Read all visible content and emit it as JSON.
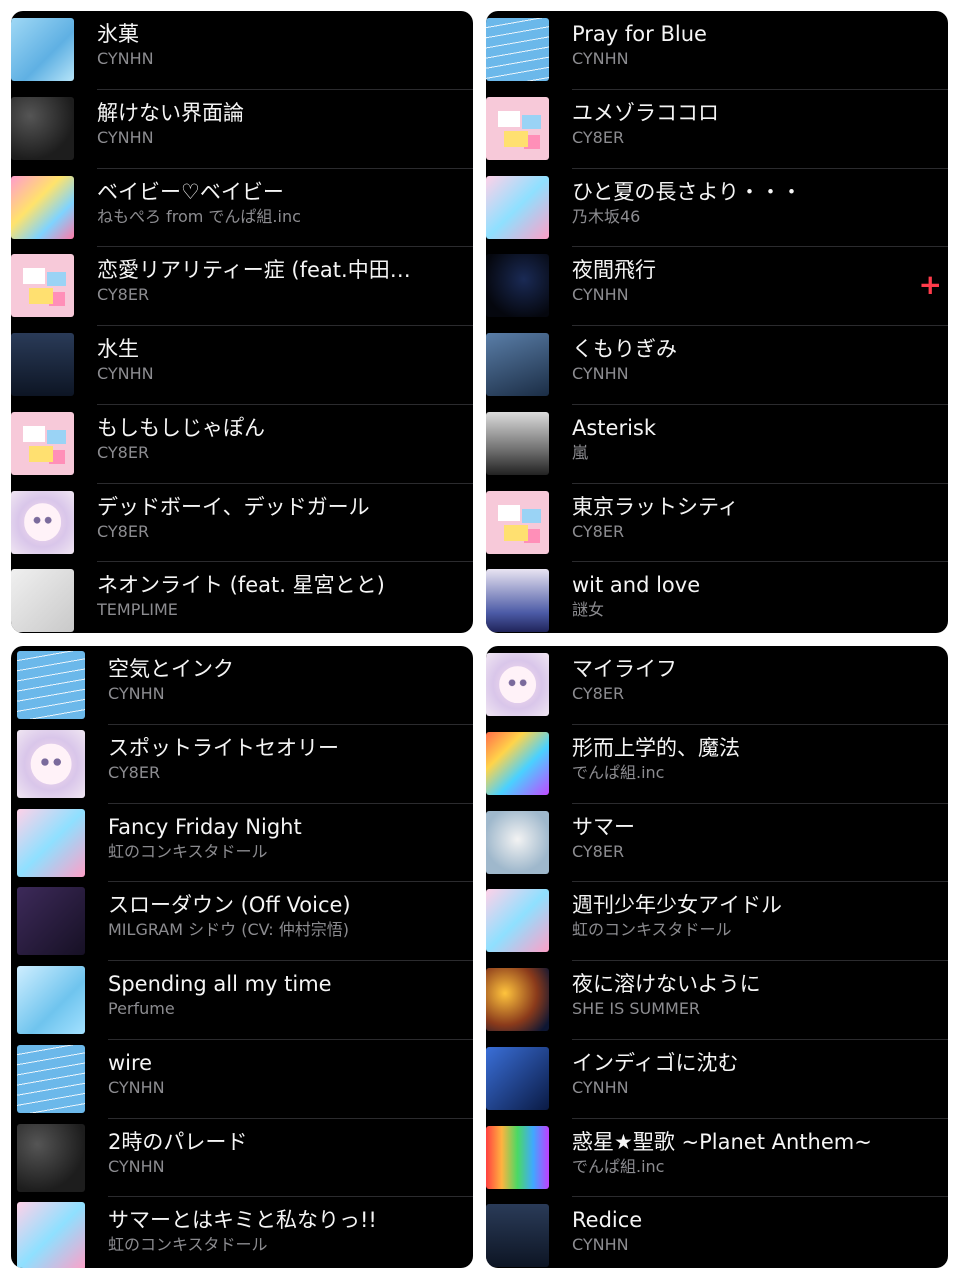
{
  "panels": [
    {
      "tracks": [
        {
          "title": "氷菓",
          "artist": "CYNHN",
          "art": "a-blue"
        },
        {
          "title": "解けない界面論",
          "artist": "CYNHN",
          "art": "a-dark"
        },
        {
          "title": "ベイビー♡ベイビー",
          "artist": "ねもぺろ from でんぱ組.inc",
          "art": "a-pop"
        },
        {
          "title": "恋愛リアリティー症 (feat.中田…",
          "artist": "CY8ER",
          "art": "a-pink"
        },
        {
          "title": "水生",
          "artist": "CYNHN",
          "art": "a-night"
        },
        {
          "title": "もしもしじゃぽん",
          "artist": "CY8ER",
          "art": "a-pink"
        },
        {
          "title": "デッドボーイ、デッドガール",
          "artist": "CY8ER",
          "art": "a-skull"
        },
        {
          "title": "ネオンライト (feat. 星宮とと)",
          "artist": "TEMPLIME",
          "art": "a-gray"
        }
      ]
    },
    {
      "tracks": [
        {
          "title": "Pray for Blue",
          "artist": "CYNHN",
          "art": "a-lines"
        },
        {
          "title": "ユメゾラココロ",
          "artist": "CY8ER",
          "art": "a-pink"
        },
        {
          "title": "ひと夏の長さより・・・",
          "artist": "乃木坂46",
          "art": "a-idol"
        },
        {
          "title": "夜間飛行",
          "artist": "CYNHN",
          "art": "a-stars",
          "add": "+"
        },
        {
          "title": "くもりぎみ",
          "artist": "CYNHN",
          "art": "a-city"
        },
        {
          "title": "Asterisk",
          "artist": "嵐",
          "art": "a-group"
        },
        {
          "title": "東京ラットシティ",
          "artist": "CY8ER",
          "art": "a-pink"
        },
        {
          "title": "wit and love",
          "artist": "謎女",
          "art": "a-anime"
        }
      ]
    },
    {
      "tracks": [
        {
          "title": "空気とインク",
          "artist": "CYNHN",
          "art": "a-lines"
        },
        {
          "title": "スポットライトセオリー",
          "artist": "CY8ER",
          "art": "a-skull"
        },
        {
          "title": "Fancy Friday Night",
          "artist": "虹のコンキスタドール",
          "art": "a-idol"
        },
        {
          "title": "スローダウン (Off Voice)",
          "artist": "MILGRAM シドウ (CV: 仲村宗悟)",
          "art": "a-purple"
        },
        {
          "title": "Spending all my time",
          "artist": "Perfume",
          "art": "a-aqua"
        },
        {
          "title": "wire",
          "artist": "CYNHN",
          "art": "a-lines"
        },
        {
          "title": "2時のパレード",
          "artist": "CYNHN",
          "art": "a-dark"
        },
        {
          "title": "サマーとはキミと私なりっ!!",
          "artist": "虹のコンキスタドール",
          "art": "a-idol"
        }
      ]
    },
    {
      "tracks": [
        {
          "title": "マイライフ",
          "artist": "CY8ER",
          "art": "a-skull"
        },
        {
          "title": "形而上学的、魔法",
          "artist": "でんぱ組.inc",
          "art": "a-multi"
        },
        {
          "title": "サマー",
          "artist": "CY8ER",
          "art": "a-face"
        },
        {
          "title": "週刊少年少女アイドル",
          "artist": "虹のコンキスタドール",
          "art": "a-idol"
        },
        {
          "title": "夜に溶けないように",
          "artist": "SHE IS SUMMER",
          "art": "a-sunset"
        },
        {
          "title": "インディゴに沈む",
          "artist": "CYNHN",
          "art": "a-indigo"
        },
        {
          "title": "惑星★聖歌 ~Planet Anthem~",
          "artist": "でんぱ組.inc",
          "art": "a-rainbow"
        },
        {
          "title": "Redice",
          "artist": "CYNHN",
          "art": "a-night"
        }
      ]
    }
  ]
}
